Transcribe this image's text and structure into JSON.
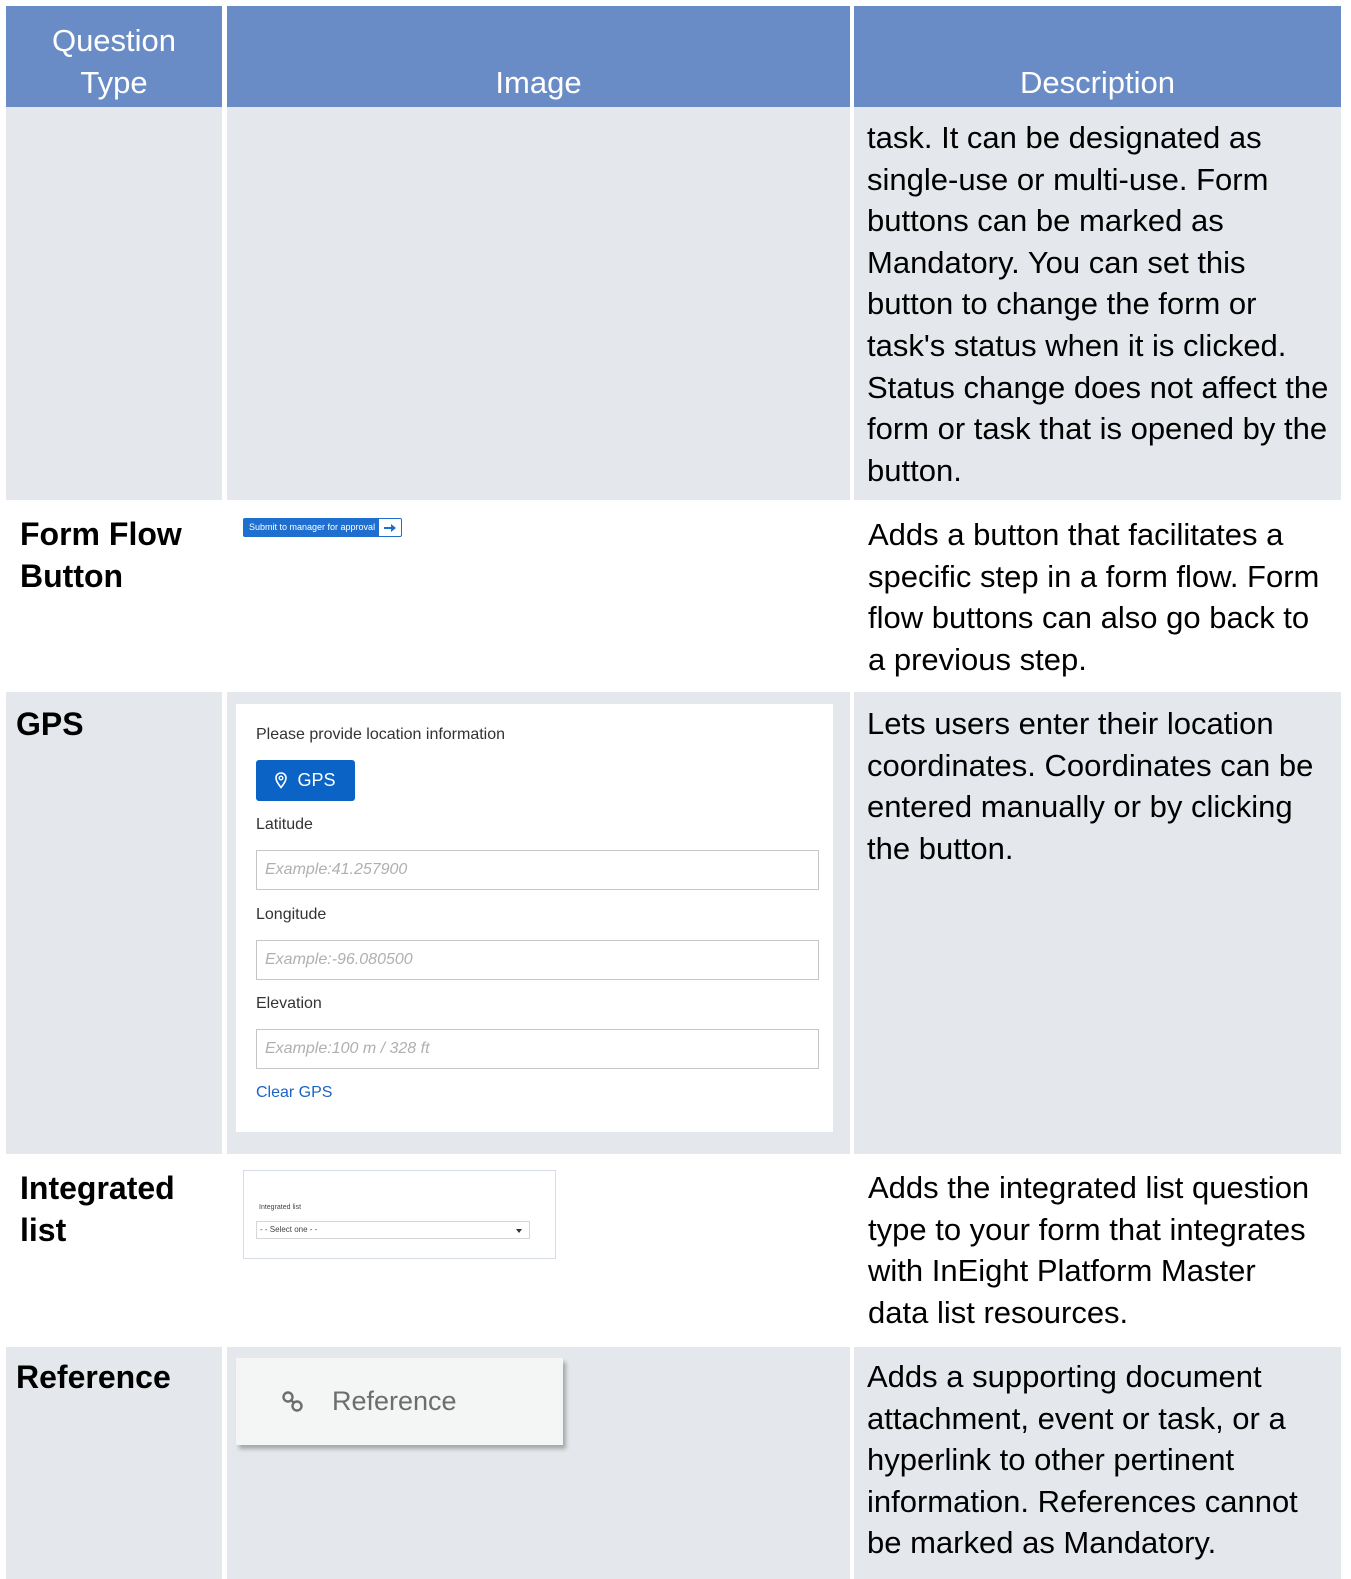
{
  "header": {
    "question_type_line1": "Question",
    "question_type_line2": "Type",
    "image": "Image",
    "description": "Description"
  },
  "rows": {
    "continued": {
      "description_lines": [
        "task. It can be designated as",
        "single-use or multi-use. Form",
        "buttons can be marked as",
        "Mandatory. You can set this",
        "button to change the form or",
        "task's status when it is clicked.",
        "Status change does not affect the",
        "form or task that is opened by the",
        "button."
      ]
    },
    "form_flow": {
      "type_lines": [
        "Form Flow",
        "Button"
      ],
      "button_label": "Submit to manager for approval",
      "description_lines": [
        "Adds a button that facilitates a",
        "specific step in a form flow. Form",
        "flow buttons can also go back to",
        "a previous step."
      ]
    },
    "gps": {
      "type_lines": [
        "GPS"
      ],
      "prompt": "Please provide location information",
      "button_label": "GPS",
      "latitude_label": "Latitude",
      "latitude_placeholder": "Example:41.257900",
      "longitude_label": "Longitude",
      "longitude_placeholder": "Example:-96.080500",
      "elevation_label": "Elevation",
      "elevation_placeholder": "Example:100 m / 328 ft",
      "clear_label": "Clear GPS",
      "description_lines": [
        "Lets users enter their location",
        "coordinates. Coordinates can be",
        "entered manually or by clicking",
        "the button."
      ]
    },
    "integrated_list": {
      "type_lines": [
        "Integrated",
        "list"
      ],
      "field_label": "Integrated list",
      "select_value": "- - Select one - -",
      "description_lines": [
        "Adds the integrated list question",
        "type to your form that integrates",
        "with InEight Platform Master",
        "data list resources."
      ]
    },
    "reference": {
      "type_lines": [
        "Reference"
      ],
      "button_label": "Reference",
      "description_lines": [
        "Adds a supporting document",
        "attachment, event or task, or a",
        "hyperlink to other pertinent",
        "information. References cannot",
        "be marked as Mandatory."
      ]
    }
  },
  "colors": {
    "header_bg": "#6a8cc6",
    "shaded_row_bg": "#e4e8ec",
    "accent_blue": "#0b63c6",
    "link_blue": "#1b64c4"
  },
  "icons": {
    "gps_button": "map-pin-icon",
    "reference_button": "link-icon",
    "form_flow_button": "arrow-right-icon",
    "integrated_list_select": "chevron-down-icon"
  }
}
